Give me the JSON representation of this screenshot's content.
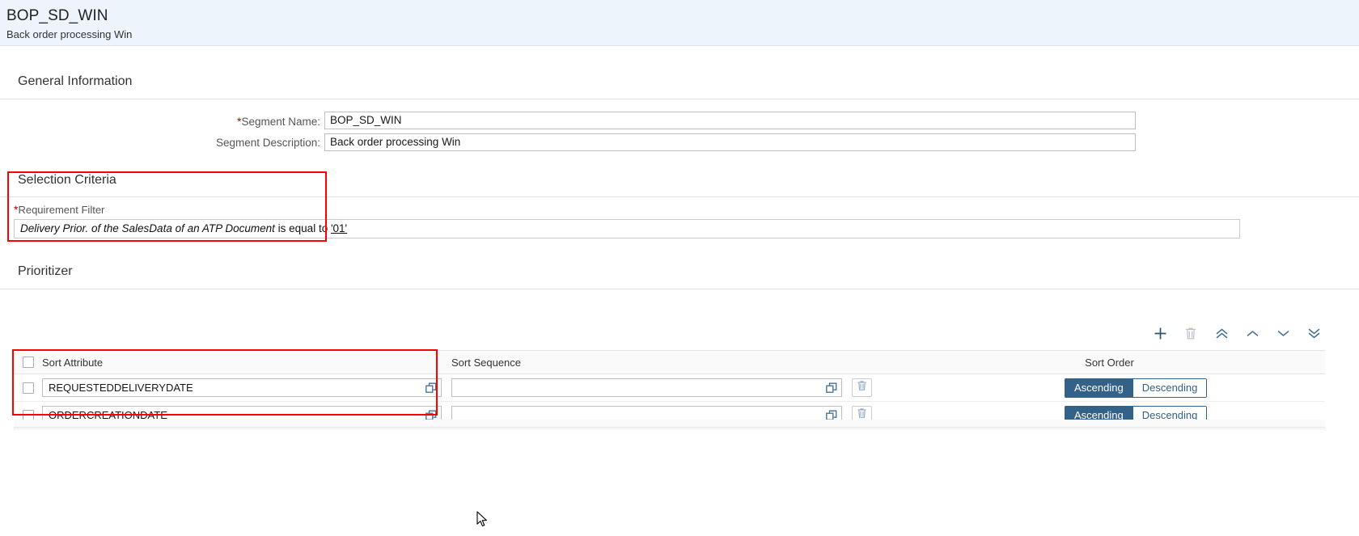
{
  "header": {
    "title": "BOP_SD_WIN",
    "subtitle": "Back order processing Win"
  },
  "general_information": {
    "section_title": "General Information",
    "fields": [
      {
        "label": "Segment Name:",
        "required": true,
        "value": "BOP_SD_WIN"
      },
      {
        "label": "Segment Description:",
        "required": false,
        "value": "Back order processing Win"
      }
    ]
  },
  "selection_criteria": {
    "section_title": "Selection Criteria",
    "requirement_filter_label": "Requirement Filter",
    "requirement_filter_required": true,
    "filter_parts": {
      "subject": "Delivery Prior. of the SalesData of an ATP Document",
      "operator": "is equal to",
      "value": "'01'"
    }
  },
  "prioritizer": {
    "section_title": "Prioritizer",
    "toolbar": [
      {
        "name": "add-row-button",
        "icon": "plus-icon",
        "enabled": true
      },
      {
        "name": "delete-row-button",
        "icon": "trash-icon",
        "enabled": false
      },
      {
        "name": "move-to-top-button",
        "icon": "double-chevron-up-icon",
        "enabled": true
      },
      {
        "name": "move-up-button",
        "icon": "chevron-up-icon",
        "enabled": true
      },
      {
        "name": "move-down-button",
        "icon": "chevron-down-icon",
        "enabled": true
      },
      {
        "name": "move-to-bottom-button",
        "icon": "double-chevron-down-icon",
        "enabled": true
      }
    ],
    "columns": {
      "sort_attribute": "Sort Attribute",
      "sort_sequence": "Sort Sequence",
      "sort_order": "Sort Order"
    },
    "sort_order_options": {
      "ascending": "Ascending",
      "descending": "Descending"
    },
    "rows": [
      {
        "sort_attribute": "REQUESTEDDELIVERYDATE",
        "sort_sequence": "",
        "sort_order": "Ascending",
        "selected": false
      },
      {
        "sort_attribute": "ORDERCREATIONDATE",
        "sort_sequence": "",
        "sort_order": "Ascending",
        "selected": false
      }
    ]
  },
  "colors": {
    "header_bg": "#edf4fb",
    "accent": "#346187",
    "required_star": "#b00000",
    "highlight_box": "#ff0000"
  }
}
